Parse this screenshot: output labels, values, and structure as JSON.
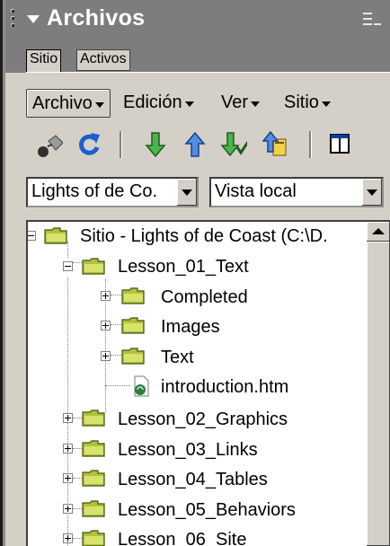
{
  "panel": {
    "title": "Archivos",
    "tabs": [
      {
        "label": "Sitio",
        "active": true
      },
      {
        "label": "Activos",
        "active": false
      }
    ]
  },
  "menus": [
    "Archivo",
    "Edición",
    "Ver",
    "Sitio"
  ],
  "toolbar_icons": [
    "connect-icon",
    "refresh-icon",
    "get-files-icon",
    "put-files-icon",
    "check-out-icon",
    "check-in-icon",
    "expand-view-icon"
  ],
  "site_select": {
    "value": "Lights of de Co."
  },
  "view_select": {
    "value": "Vista local"
  },
  "tree": {
    "root": "Sitio - Lights of de Coast (C:\\D.",
    "items": [
      {
        "label": "Lesson_01_Text"
      },
      {
        "label": "Completed"
      },
      {
        "label": "Images"
      },
      {
        "label": "Text"
      },
      {
        "label": "introduction.htm"
      },
      {
        "label": "Lesson_02_Graphics"
      },
      {
        "label": "Lesson_03_Links"
      },
      {
        "label": "Lesson_04_Tables"
      },
      {
        "label": "Lesson_05_Behaviors"
      },
      {
        "label": "Lesson_06_Site"
      }
    ]
  },
  "colors": {
    "panel_header": "#7d7d7d",
    "panel_face": "#d4d0c8",
    "folder_fill": "#b3c13a",
    "folder_dark": "#3d5410"
  }
}
